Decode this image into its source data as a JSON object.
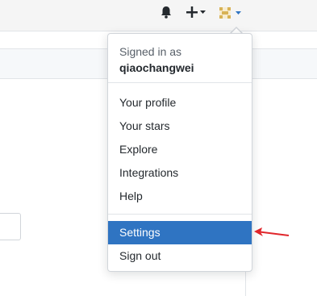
{
  "header": {
    "icons": [
      "bell-icon",
      "plus-icon",
      "caret-down-icon",
      "avatar",
      "caret-down-icon"
    ]
  },
  "dropdown": {
    "signed_in_label": "Signed in as",
    "username": "qiaochangwei",
    "items": [
      {
        "label": "Your profile"
      },
      {
        "label": "Your stars"
      },
      {
        "label": "Explore"
      },
      {
        "label": "Integrations"
      },
      {
        "label": "Help"
      },
      {
        "label": "Settings"
      },
      {
        "label": "Sign out"
      }
    ],
    "active_item": "Settings"
  },
  "colors": {
    "active_background": "#2f74c2",
    "annotation_arrow": "#e0262b",
    "avatar_color": "#d8b256"
  }
}
